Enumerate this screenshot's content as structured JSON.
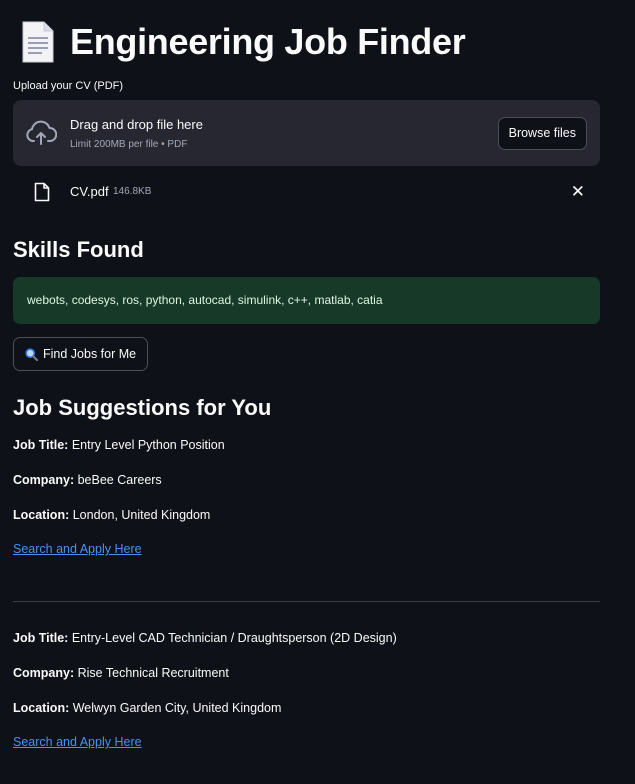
{
  "app": {
    "title": "Engineering Job Finder",
    "title_icon": "document-icon"
  },
  "uploader": {
    "label": "Upload your CV (PDF)",
    "drop_title": "Drag and drop file here",
    "drop_subtitle": "Limit 200MB per file • PDF",
    "browse_label": "Browse files",
    "file": {
      "name": "CV.pdf",
      "size": "146.8KB"
    }
  },
  "skills": {
    "heading": "Skills Found",
    "text": "webots, codesys, ros, python, autocad, simulink, c++, matlab, catia"
  },
  "find_button": {
    "label": "Find Jobs for Me",
    "icon": "magnifier-icon"
  },
  "jobs": {
    "heading": "Job Suggestions for You",
    "labels": {
      "title": "Job Title:",
      "company": "Company:",
      "location": "Location:"
    },
    "items": [
      {
        "title": "Entry Level Python Position",
        "company": "beBee Careers",
        "location": "London, United Kingdom",
        "link_text": "Search and Apply Here"
      },
      {
        "title": "Entry-Level CAD Technician / Draughtsperson (2D Design)",
        "company": "Rise Technical Recruitment",
        "location": "Welwyn Garden City, United Kingdom",
        "link_text": "Search and Apply Here"
      }
    ]
  },
  "colors": {
    "background": "#0e1117",
    "surface": "#262730",
    "success_bg": "#173928",
    "link": "#4593f5"
  }
}
